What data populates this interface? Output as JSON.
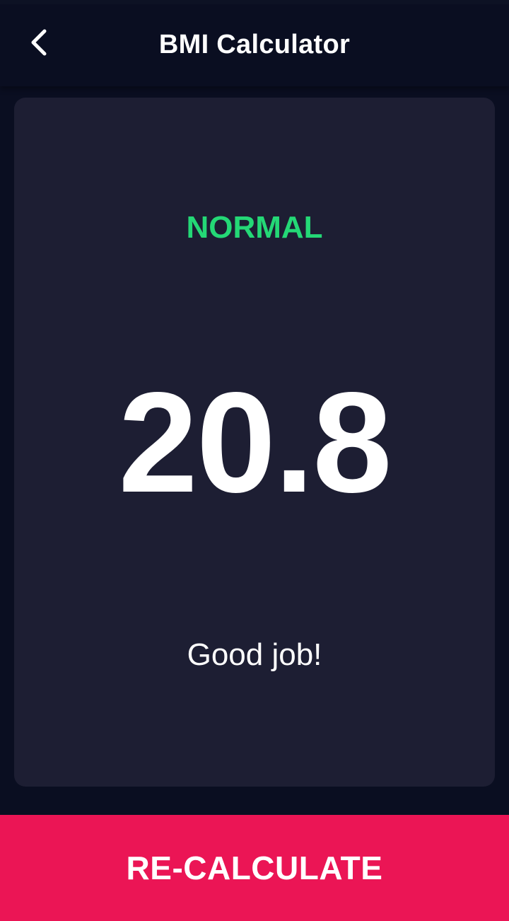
{
  "header": {
    "title": "BMI Calculator",
    "back_icon": "chevron-left-icon"
  },
  "result": {
    "status": "NORMAL",
    "bmi": "20.8",
    "message": "Good job!"
  },
  "actions": {
    "recalculate_label": "RE-CALCULATE"
  },
  "colors": {
    "background": "#0a0e21",
    "card": "#1d1e33",
    "status_normal": "#24d876",
    "accent": "#eb1555",
    "text": "#ffffff"
  }
}
